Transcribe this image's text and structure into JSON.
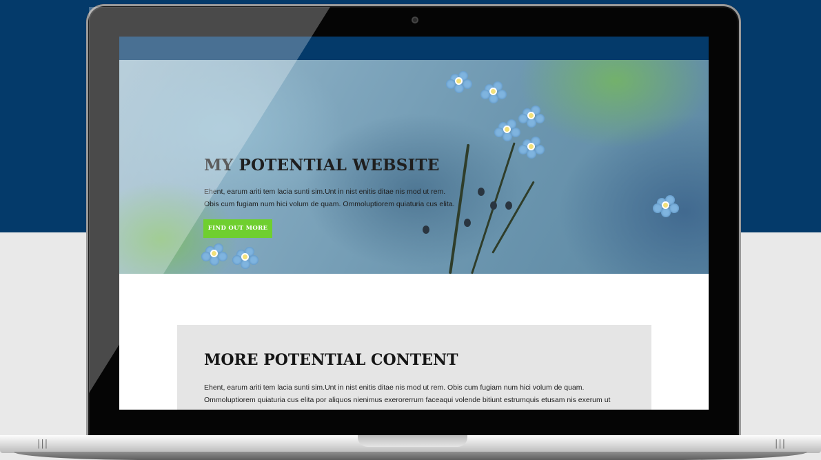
{
  "hero": {
    "title": "MY POTENTIAL WEBSITE",
    "text_line1": "Ehent, earum ariti tem lacia sunti sim.Unt in nist enitis ditae nis mod ut rem.",
    "text_line2": "Obis cum fugiam num hici volum de quam. Ommoluptiorem quiaturia cus elita.",
    "button_label": "FIND OUT MORE",
    "button_color": "#6fcf2f"
  },
  "content": {
    "title": "MORE POTENTIAL CONTENT",
    "text_line1": "Ehent, earum ariti tem lacia sunti sim.Unt in nist enitis ditae nis mod ut rem. Obis cum fugiam num hici volum de quam.",
    "text_line2": "Ommoluptiorem quiaturia cus elita por aliquos nienimus exerorerrum faceaqui volende bitiunt estrumquis etusam nis exerum ut"
  },
  "colors": {
    "navbar": "#043a6a",
    "background_top": "#043a6a",
    "content_box": "#e5e5e5"
  },
  "icons": {
    "base_left_vent": "vent-icon",
    "base_right_vent": "vent-icon"
  }
}
